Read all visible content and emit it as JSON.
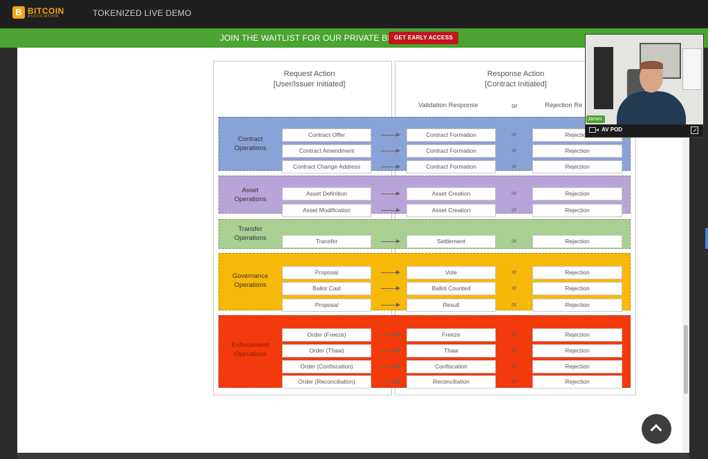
{
  "app": {
    "logo": {
      "main": "BITCOIN",
      "sub": "ASSOCIATION",
      "badge": "B"
    },
    "title": "TOKENIZED LIVE DEMO"
  },
  "banner": {
    "text": "JOIN THE WAITLIST FOR OUR PRIVATE BETA",
    "button": "GET EARLY ACCESS"
  },
  "colors": {
    "contract": "#8aa3d6",
    "asset": "#b8a4d9",
    "transfer": "#a9cf93",
    "governance": "#f7b909",
    "enforcement": "#f23a0c",
    "banner_green": "#4ba331",
    "cta_red": "#c0161c"
  },
  "diagram": {
    "request_header": [
      "Request Action",
      "[User/Issuer Initiated]"
    ],
    "response_header": [
      "Response Action",
      "[Contract Initiated]"
    ],
    "validation_label": "Validation Response",
    "or_label": "or",
    "rejection_label": "Rejection Re",
    "groups": [
      {
        "key": "contract",
        "label": [
          "Contract",
          "Operations"
        ],
        "rows": [
          {
            "request": "Contract Offer",
            "response": "Contract Formation",
            "or": "or",
            "reject": "Rejection"
          },
          {
            "request": "Contract Amendment",
            "response": "Contract Formation",
            "or": "or",
            "reject": "Rejection"
          },
          {
            "request": "Contract Change Address",
            "response": "Contract Formation",
            "or": "or",
            "reject": "Rejection"
          }
        ]
      },
      {
        "key": "asset",
        "label": [
          "Asset",
          "Operations"
        ],
        "rows": [
          {
            "request": "Asset Definition",
            "response": "Asset Creation",
            "or": "or",
            "reject": "Rejection"
          },
          {
            "request": "Asset Modification",
            "response": "Asset Creation",
            "or": "or",
            "reject": "Rejection"
          }
        ]
      },
      {
        "key": "transfer",
        "label": [
          "Transfer",
          "Operations"
        ],
        "rows": [
          {
            "request": "Transfer",
            "response": "Settlement",
            "or": "or",
            "reject": "Rejection"
          }
        ]
      },
      {
        "key": "governance",
        "label": [
          "Governance",
          "Operations"
        ],
        "rows": [
          {
            "request": "Proposal",
            "response": "Vote",
            "or": "or",
            "reject": "Rejection"
          },
          {
            "request": "Ballot Cast",
            "response": "Ballot Counted",
            "or": "or",
            "reject": "Rejection"
          },
          {
            "request": "Proposal",
            "response": "Result",
            "or": "or",
            "reject": "Rejection"
          }
        ]
      },
      {
        "key": "enforcement",
        "label": [
          "Enforcement",
          "Operations"
        ],
        "rows": [
          {
            "request": "Order (Freeze)",
            "response": "Freeze",
            "or": "or",
            "reject": "Rejection"
          },
          {
            "request": "Order (Thaw)",
            "response": "Thaw",
            "or": "or",
            "reject": "Rejection"
          },
          {
            "request": "Order (Confiscation)",
            "response": "Confiscation",
            "or": "or",
            "reject": "Rejection"
          },
          {
            "request": "Order (Reconciliation)",
            "response": "Reconciliation",
            "or": "or",
            "reject": "Rejection"
          }
        ]
      }
    ]
  },
  "video": {
    "speaker": "James",
    "pod": "AV POD",
    "icons": {
      "camera": "camera-icon",
      "expand": "expand-icon"
    }
  },
  "scroll_top_icon": "chevron-up-icon"
}
